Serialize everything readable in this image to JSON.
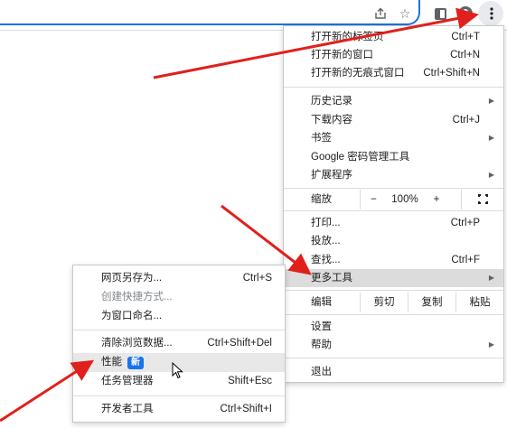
{
  "toolbar": {
    "icons": [
      "share-icon",
      "star-icon",
      "side-panel-icon",
      "profile-icon",
      "more-menu-icon"
    ]
  },
  "menu": {
    "new_tab": {
      "label": "打开新的标签页",
      "shortcut": "Ctrl+T"
    },
    "new_window": {
      "label": "打开新的窗口",
      "shortcut": "Ctrl+N"
    },
    "new_incognito": {
      "label": "打开新的无痕式窗口",
      "shortcut": "Ctrl+Shift+N"
    },
    "history": {
      "label": "历史记录"
    },
    "downloads": {
      "label": "下载内容",
      "shortcut": "Ctrl+J"
    },
    "bookmarks": {
      "label": "书签"
    },
    "passwords": {
      "label": "Google 密码管理工具"
    },
    "extensions": {
      "label": "扩展程序"
    },
    "zoom": {
      "label": "缩放",
      "minus": "−",
      "value": "100%",
      "plus": "+"
    },
    "print": {
      "label": "打印...",
      "shortcut": "Ctrl+P"
    },
    "cast": {
      "label": "投放..."
    },
    "find": {
      "label": "查找...",
      "shortcut": "Ctrl+F"
    },
    "more_tools": {
      "label": "更多工具"
    },
    "edit": {
      "label": "编辑",
      "cut": "剪切",
      "copy": "复制",
      "paste": "粘贴"
    },
    "settings": {
      "label": "设置"
    },
    "help": {
      "label": "帮助"
    },
    "exit": {
      "label": "退出"
    }
  },
  "submenu": {
    "save_page": {
      "label": "网页另存为...",
      "shortcut": "Ctrl+S"
    },
    "create_shortcut": {
      "label": "创建快捷方式..."
    },
    "name_window": {
      "label": "为窗口命名..."
    },
    "clear_data": {
      "label": "清除浏览数据...",
      "shortcut": "Ctrl+Shift+Del"
    },
    "performance": {
      "label": "性能",
      "badge": "新"
    },
    "task_manager": {
      "label": "任务管理器",
      "shortcut": "Shift+Esc"
    },
    "devtools": {
      "label": "开发者工具",
      "shortcut": "Ctrl+Shift+I"
    }
  },
  "colors": {
    "accent": "#1a73e8",
    "arrow": "#e0201c",
    "highlight": "#dcdcdc"
  }
}
